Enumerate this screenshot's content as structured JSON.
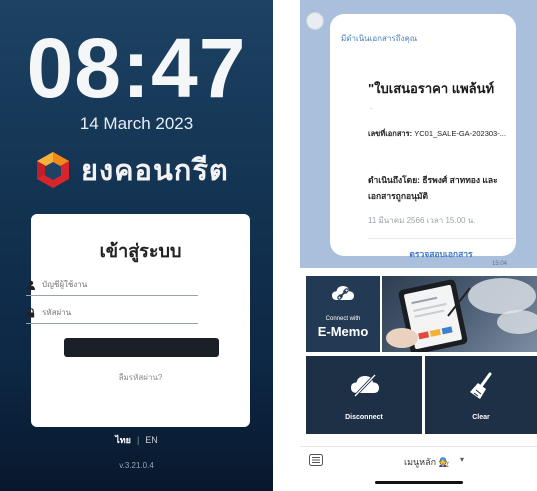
{
  "left_screen": {
    "clock": "08:47",
    "date": "14 March 2023",
    "brand_name": "ยงคอนกรีต",
    "login": {
      "title": "เข้าสู่ระบบ",
      "username_placeholder": "บัญชีผู้ใช้งาน",
      "password_placeholder": "รหัสผ่าน",
      "forgot_label": "ลืมรหัสผ่าน?"
    },
    "languages": {
      "thai": "ไทย",
      "english": "EN",
      "active": "ไทย"
    },
    "version": "v.3.21.0.4"
  },
  "right_screen": {
    "message": {
      "header": "มีดำเนินเอกสารถึงคุณ",
      "title": "\"ใบเสนอราคา   แพล้นท์",
      "dot": "-",
      "doc_label": "เลขที่เอกสาร:",
      "doc_number": " YC01_SALE-GA-202303-...",
      "by_line": "ดำเนินถึงโดย: ธีรพงศ์ สาททอง และเอกสารถูกอนุมัติ",
      "time": "11 มีนาคม 2566 เวลา 15.00 น.",
      "action": "ตรวจสอบเอกสาร",
      "sent_time": "15:04"
    },
    "menu_tiles": {
      "memo_small": "Connect with",
      "memo_big": "E-Memo",
      "disconnect": "Disconnect",
      "clear": "Clear"
    },
    "bottom_bar": {
      "menu_label": "เมนูหลัก 🧑‍🔧",
      "caret": "▾"
    }
  },
  "colors": {
    "brand_orange": "#f08a1c",
    "brand_red": "#d7262b",
    "link_blue": "#3f78c4",
    "tile_navy": "#1d3046",
    "chat_bg": "#a9bfdc"
  },
  "icons": [
    "user-icon",
    "lock-icon",
    "cloud-link-icon",
    "cloud-off-icon",
    "broom-icon",
    "keyboard-icon"
  ]
}
